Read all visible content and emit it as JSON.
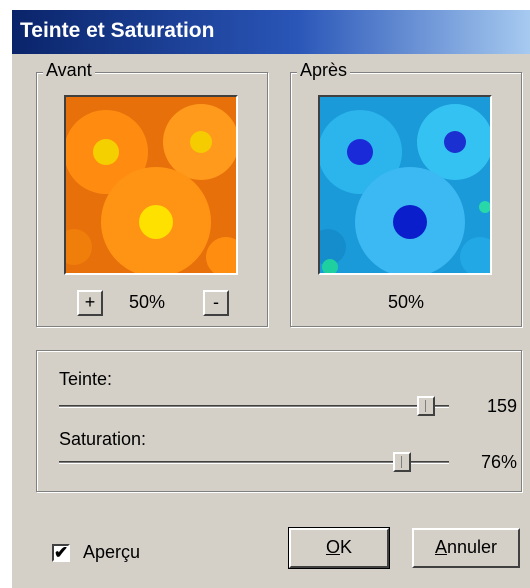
{
  "window": {
    "title": "Teinte et Saturation"
  },
  "before": {
    "label": "Avant",
    "zoom": "50%",
    "zoom_in": "+",
    "zoom_out": "-"
  },
  "after": {
    "label": "Après",
    "zoom": "50%"
  },
  "sliders": {
    "hue": {
      "label": "Teinte:",
      "value": "159",
      "min": -180,
      "max": 180,
      "level": 159
    },
    "saturation": {
      "label": "Saturation:",
      "value": "76%",
      "min": -100,
      "max": 100,
      "level": 76
    }
  },
  "preview_checkbox": {
    "label": "Aperçu",
    "checked": true,
    "mark": "✔"
  },
  "buttons": {
    "ok": {
      "mnemonic": "O",
      "rest": "K"
    },
    "cancel": {
      "mnemonic": "A",
      "rest": "nnuler"
    }
  },
  "colors": {
    "before_tint": "#ff9b1a",
    "after_tint": "#2fb8f0",
    "titlebar": "#0a246a"
  },
  "icons": {
    "before_image": "orange-flower-photo",
    "after_image": "blue-flower-photo"
  }
}
